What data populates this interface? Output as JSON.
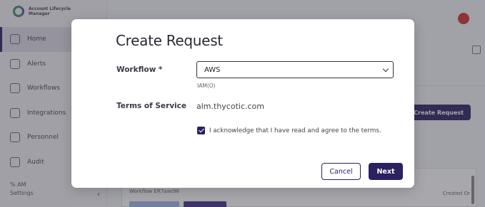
{
  "background": {
    "brand": {
      "line1": "Account Lifecycle",
      "line2": "Manager"
    },
    "nav": [
      {
        "label": "Home",
        "icon": "home-icon",
        "active": true
      },
      {
        "label": "Alerts",
        "icon": "bell-icon",
        "active": false
      },
      {
        "label": "Workflows",
        "icon": "clipboard-icon",
        "active": false
      },
      {
        "label": "Integrations",
        "icon": "grid-icon",
        "active": false
      },
      {
        "label": "Personnel",
        "icon": "people-icon",
        "active": false
      },
      {
        "label": "Audit",
        "icon": "audit-icon",
        "active": false
      }
    ],
    "footer": {
      "line1": "% AM",
      "line2": "Settings"
    },
    "create_button": "Create Request",
    "table": {
      "row_label": "Workflow",
      "row_value": "ER7aae96",
      "right_col": "Created Or"
    }
  },
  "modal": {
    "title": "Create Request",
    "workflow_label": "Workflow *",
    "workflow_value": "AWS",
    "workflow_hint": "IAM(O)",
    "terms_label": "Terms of Service",
    "terms_value": "alm.thycotic.com",
    "ack_text": "I acknowledge that I have read and agree to the terms.",
    "ack_checked": true,
    "cancel_label": "Cancel",
    "next_label": "Next"
  },
  "colors": {
    "primary": "#2b2060",
    "overlay": "rgba(60,60,70,0.45)",
    "alert": "#d0312d"
  }
}
